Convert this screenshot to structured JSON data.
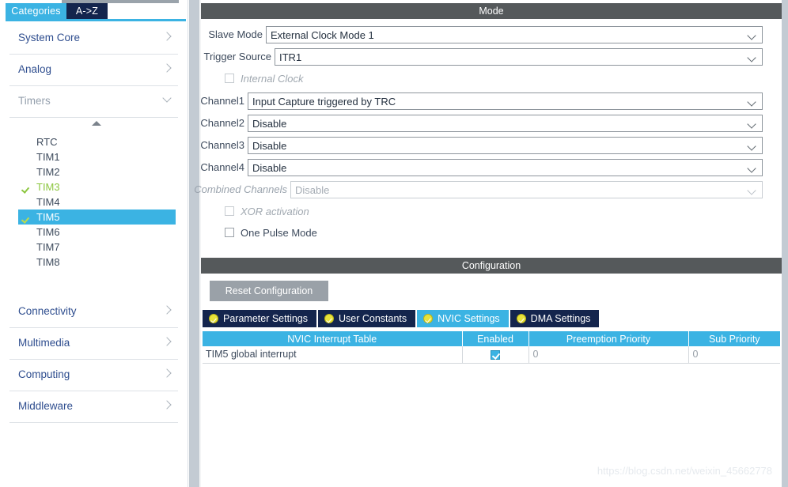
{
  "sidebar": {
    "tabs": [
      {
        "label": "Categories",
        "active": true
      },
      {
        "label": "A->Z",
        "active": false
      }
    ],
    "categories_top": [
      {
        "label": "System Core",
        "state": "collapsed"
      },
      {
        "label": "Analog",
        "state": "collapsed"
      },
      {
        "label": "Timers",
        "state": "expanded"
      }
    ],
    "timers": [
      {
        "label": "RTC",
        "checked": false,
        "selected": false
      },
      {
        "label": "TIM1",
        "checked": false,
        "selected": false
      },
      {
        "label": "TIM2",
        "checked": false,
        "selected": false
      },
      {
        "label": "TIM3",
        "checked": true,
        "selected": false
      },
      {
        "label": "TIM4",
        "checked": false,
        "selected": false
      },
      {
        "label": "TIM5",
        "checked": true,
        "selected": true
      },
      {
        "label": "TIM6",
        "checked": false,
        "selected": false
      },
      {
        "label": "TIM7",
        "checked": false,
        "selected": false
      },
      {
        "label": "TIM8",
        "checked": false,
        "selected": false
      }
    ],
    "categories_bottom": [
      {
        "label": "Connectivity",
        "state": "collapsed"
      },
      {
        "label": "Multimedia",
        "state": "collapsed"
      },
      {
        "label": "Computing",
        "state": "collapsed"
      },
      {
        "label": "Middleware",
        "state": "collapsed"
      }
    ],
    "scroll_up_icon": "triangle-up-icon"
  },
  "mode": {
    "title": "Mode",
    "fields": [
      {
        "label": "Slave Mode",
        "value": "External Clock Mode 1",
        "disabled": false
      },
      {
        "label": "Trigger Source",
        "value": "ITR1",
        "disabled": false
      },
      {
        "label": "Channel1",
        "value": "Input Capture triggered by TRC",
        "disabled": false
      },
      {
        "label": "Channel2",
        "value": "Disable",
        "disabled": false
      },
      {
        "label": "Channel3",
        "value": "Disable",
        "disabled": false
      },
      {
        "label": "Channel4",
        "value": "Disable",
        "disabled": false
      },
      {
        "label": "Combined Channels",
        "value": "Disable",
        "disabled": true
      }
    ],
    "checkboxes": [
      {
        "label": "Internal Clock",
        "checked": false,
        "disabled": true
      },
      {
        "label": "XOR activation",
        "checked": false,
        "disabled": true
      },
      {
        "label": "One Pulse Mode",
        "checked": false,
        "disabled": false
      }
    ]
  },
  "configuration": {
    "title": "Configuration",
    "reset_label": "Reset Configuration",
    "tabs": [
      {
        "label": "Parameter Settings",
        "active": false
      },
      {
        "label": "User Constants",
        "active": false
      },
      {
        "label": "NVIC Settings",
        "active": true
      },
      {
        "label": "DMA Settings",
        "active": false
      }
    ],
    "table": {
      "headers": [
        "NVIC Interrupt Table",
        "Enabled",
        "Preemption Priority",
        "Sub Priority"
      ],
      "rows": [
        {
          "name": "TIM5 global interrupt",
          "enabled": true,
          "preemption": "0",
          "sub": "0"
        }
      ]
    }
  },
  "watermark": "https://blog.csdn.net/weixin_45662778",
  "colors": {
    "accent_blue": "#3bb3e3",
    "tab_navy": "#14254d",
    "header_gray": "#55595b",
    "checked_green": "#8cc63f"
  }
}
